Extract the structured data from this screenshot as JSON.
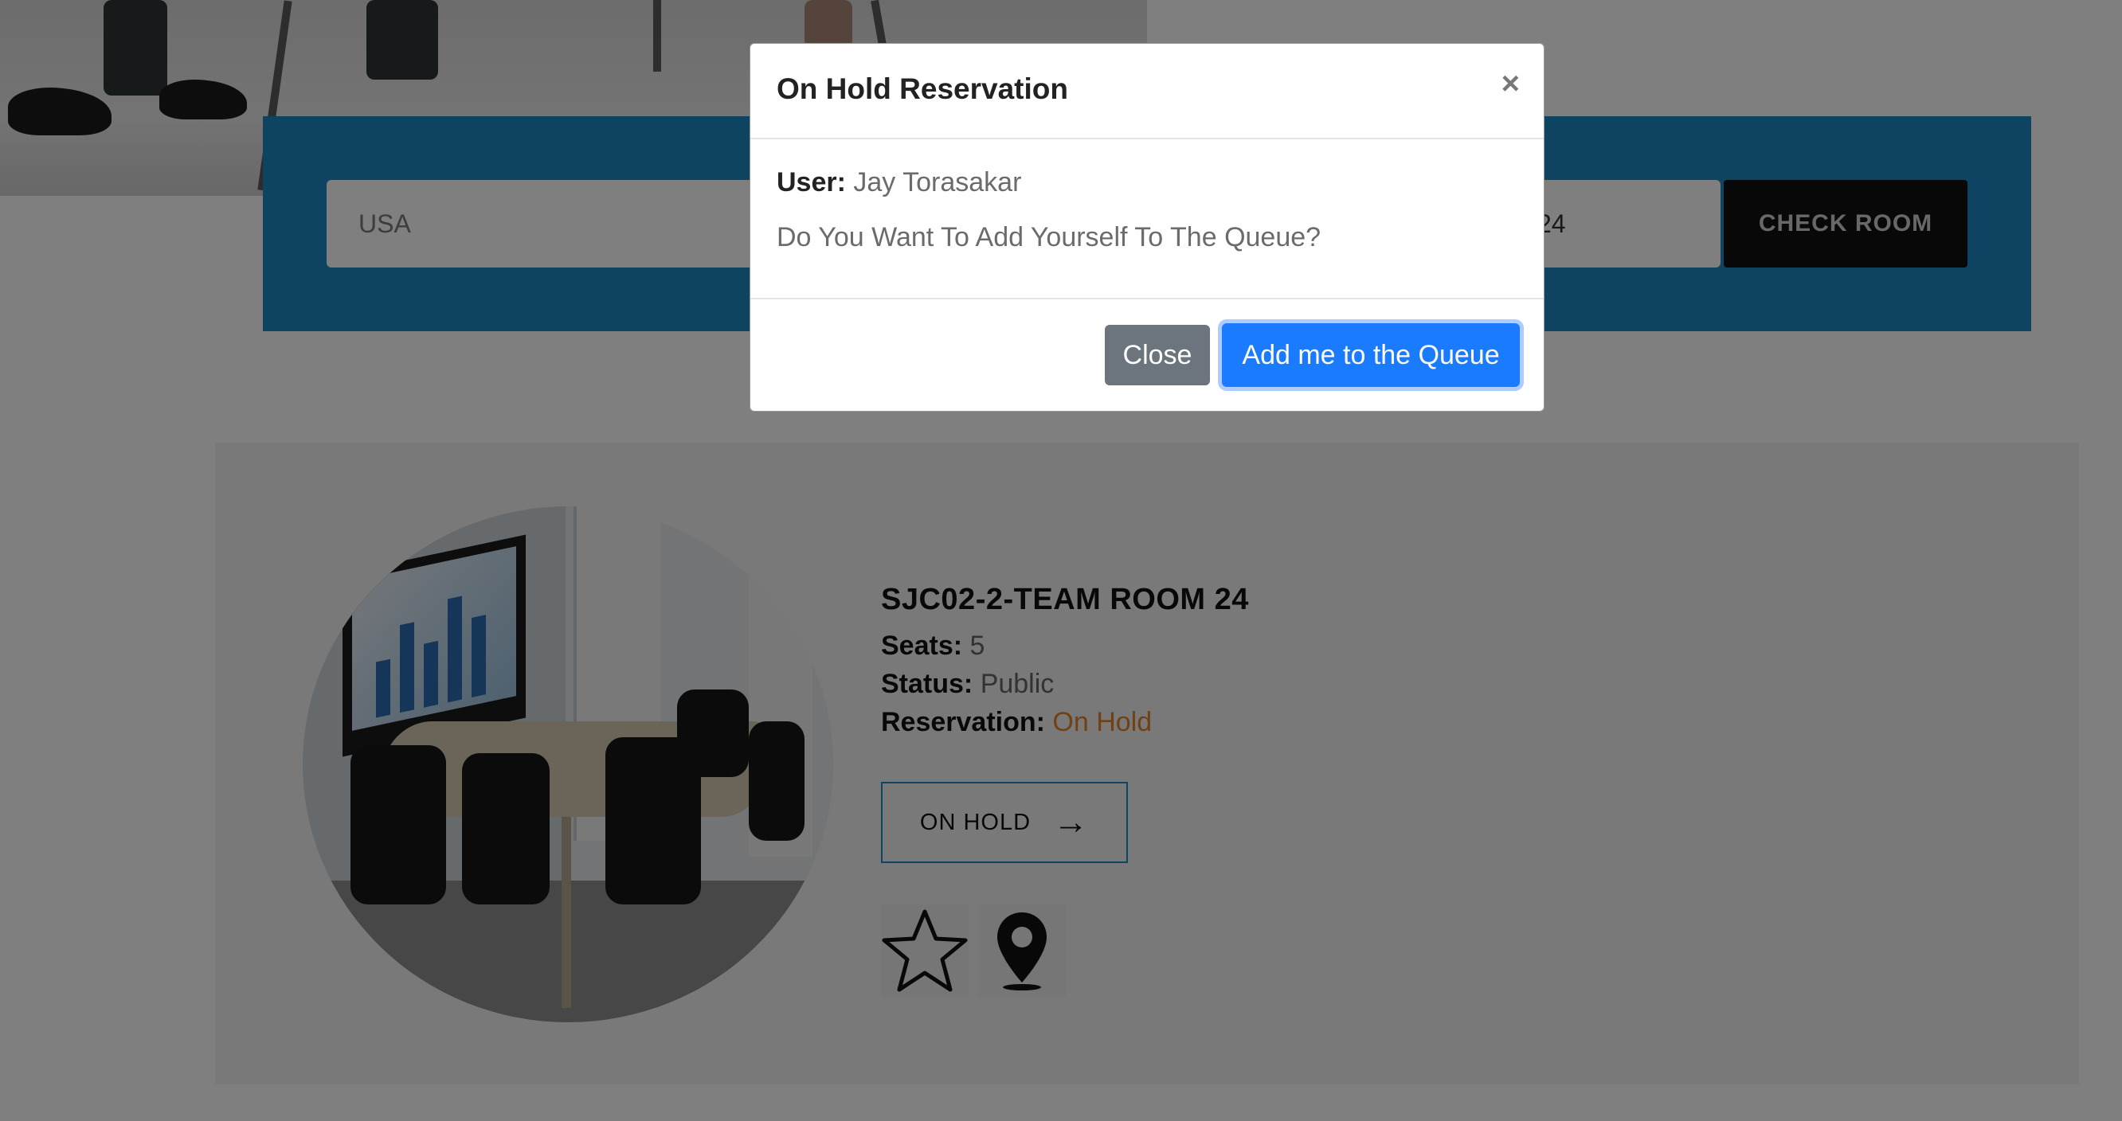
{
  "search": {
    "country_value": "USA",
    "room_value": "24",
    "check_label": "CHECK ROOM"
  },
  "room": {
    "title": "SJC02-2-TEAM ROOM 24",
    "seats_label": "Seats:",
    "seats_value": "5",
    "status_label": "Status:",
    "status_value": "Public",
    "reservation_label": "Reservation:",
    "reservation_value": "On Hold",
    "on_hold_button": "ON HOLD",
    "icons": [
      "star-icon",
      "map-pin-icon"
    ]
  },
  "modal": {
    "title": "On Hold Reservation",
    "close_glyph": "×",
    "user_label": "User:",
    "user_value": "Jay Torasakar",
    "question": "Do You Want To Add Yourself To The Queue?",
    "close_button": "Close",
    "queue_button": "Add me to the Queue"
  },
  "colors": {
    "accent_blue": "#1f86c4",
    "primary_button": "#1a7bff",
    "secondary_button": "#6c757d",
    "on_hold_orange": "#e0832b"
  }
}
